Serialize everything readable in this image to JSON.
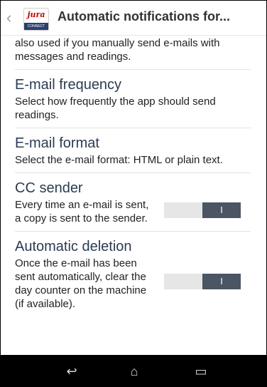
{
  "header": {
    "back_icon": "chevron-left-icon",
    "app_icon": {
      "logo_text": "jura",
      "band_text": "CONNECT"
    },
    "title": "Automatic notifications for..."
  },
  "content": {
    "intro_text": "also used if you manually send e-mails with messages and readings.",
    "sections": [
      {
        "title": "E-mail frequency",
        "description": "Select how frequently the app should send readings."
      },
      {
        "title": "E-mail format",
        "description": "Select the e-mail format: HTML or plain text."
      },
      {
        "title": "CC sender",
        "description": "Every time an e-mail is sent, a copy is sent to the sender.",
        "toggle_label": "I"
      },
      {
        "title": "Automatic deletion",
        "description": "Once the e-mail has been sent automatically, clear the day counter on the machine (if available).",
        "toggle_label": "I"
      }
    ]
  },
  "navbar": {
    "back": "↩",
    "home": "⌂",
    "recent": "▭"
  }
}
